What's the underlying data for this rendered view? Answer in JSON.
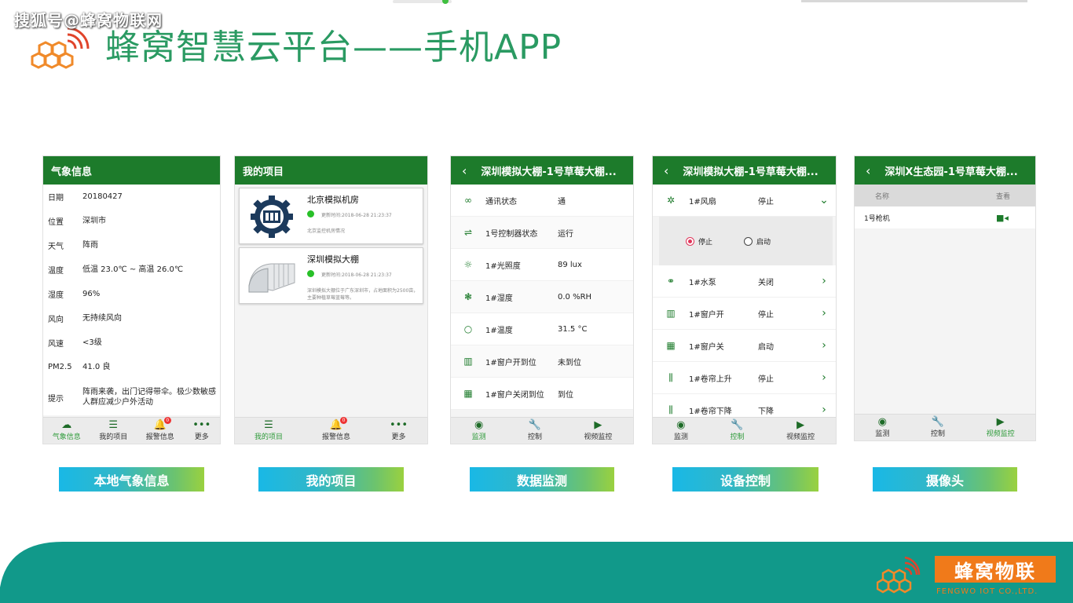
{
  "watermark": "搜狐号@蜂窝物联网",
  "title": "蜂窝智慧云平台——手机APP",
  "phone1": {
    "header": "气象信息",
    "rows": [
      {
        "k": "日期",
        "v": "20180427"
      },
      {
        "k": "位置",
        "v": "深圳市"
      },
      {
        "k": "天气",
        "v": "阵雨"
      },
      {
        "k": "温度",
        "v": "低温 23.0℃ ~ 高温 26.0℃"
      },
      {
        "k": "湿度",
        "v": "96%"
      },
      {
        "k": "风向",
        "v": "无持续风向"
      },
      {
        "k": "风速",
        "v": "<3级"
      },
      {
        "k": "PM2.5",
        "v": "41.0 良"
      },
      {
        "k": "提示",
        "v": "阵雨来袭，出门记得带伞。极少数敏感人群应减少户外活动"
      }
    ],
    "tabs": [
      "气象信息",
      "我的项目",
      "报警信息",
      "更多"
    ],
    "badge": "0"
  },
  "phone2": {
    "header": "我的项目",
    "projects": [
      {
        "name": "北京模拟机房",
        "time": "更新时间:2018-06-28 21:23:37",
        "desc": "北京监控机房情况"
      },
      {
        "name": "深圳模拟大棚",
        "time": "更新时间:2018-06-28 21:23:37",
        "desc": "深圳模拟大棚位于广东深圳市，占地面积为2500亩，主要种植草莓蓝莓等。"
      }
    ],
    "tabs": [
      "我的项目",
      "报警信息",
      "更多"
    ],
    "badge": "0"
  },
  "phone3": {
    "header": "深圳模拟大棚-1号草莓大棚...",
    "back": "‹",
    "rows": [
      {
        "icon": "∞",
        "k": "通讯状态",
        "v": "通"
      },
      {
        "icon": "⇌",
        "k": "1号控制器状态",
        "v": "运行"
      },
      {
        "icon": "☼",
        "k": "1#光照度",
        "v": "89 lux"
      },
      {
        "icon": "❃",
        "k": "1#湿度",
        "v": "0.0 %RH"
      },
      {
        "icon": "○",
        "k": "1#温度",
        "v": "31.5 °C"
      },
      {
        "icon": "▥",
        "k": "1#窗户开到位",
        "v": "未到位"
      },
      {
        "icon": "▦",
        "k": "1#窗户关闭到位",
        "v": "到位"
      }
    ],
    "tabs": [
      "监测",
      "控制",
      "视频监控"
    ]
  },
  "phone4": {
    "header": "深圳模拟大棚-1号草莓大棚...",
    "back": "‹",
    "fan": {
      "k": "1#风扇",
      "v": "停止"
    },
    "radios": [
      "停止",
      "启动"
    ],
    "rows": [
      {
        "icon": "⚭",
        "k": "1#水泵",
        "v": "关闭"
      },
      {
        "icon": "▥",
        "k": "1#窗户开",
        "v": "停止"
      },
      {
        "icon": "▦",
        "k": "1#窗户关",
        "v": "启动"
      },
      {
        "icon": "⫼",
        "k": "1#卷帘上升",
        "v": "停止"
      },
      {
        "icon": "⫼",
        "k": "1#卷帘下降",
        "v": "下降"
      }
    ],
    "tabs": [
      "监测",
      "控制",
      "视频监控"
    ]
  },
  "phone5": {
    "header": "深圳X生态园-1号草莓大棚...",
    "back": "‹",
    "col_name": "名称",
    "col_view": "查看",
    "cam": "1号枪机",
    "tabs": [
      "监测",
      "控制",
      "视频监控"
    ]
  },
  "labels": [
    "本地气象信息",
    "我的项目",
    "数据监测",
    "设备控制",
    "摄像头"
  ],
  "footer": {
    "brand": "蜂窝物联",
    "sub": "FENGWO IOT CO.,LTD."
  },
  "colors": {
    "green_header": "#1d7b2b",
    "title_green": "#2a9a62",
    "footer_teal": "#11998a",
    "brand_orange": "#f07a1a"
  }
}
